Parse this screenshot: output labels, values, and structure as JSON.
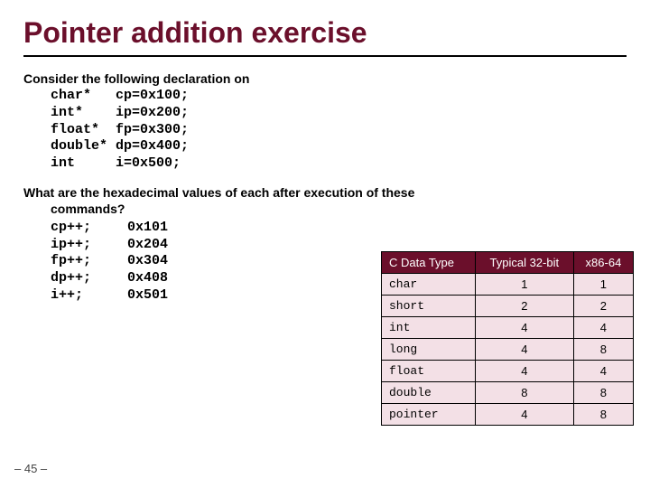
{
  "title": "Pointer addition exercise",
  "intro": "Consider the following declaration on",
  "decls": "char*   cp=0x100;\nint*    ip=0x200;\nfloat*  fp=0x300;\ndouble* dp=0x400;\nint     i=0x500;",
  "question1": "What are the hexadecimal values of each after execution of these",
  "question2": "commands?",
  "cmds": "cp++;\nip++;\nfp++;\ndp++;\ni++;",
  "answers": "0x101\n0x204\n0x304\n0x408\n0x501",
  "table": {
    "headers": [
      "C Data Type",
      "Typical 32-bit",
      "x86-64"
    ],
    "rows": [
      [
        "char",
        "1",
        "1"
      ],
      [
        "short",
        "2",
        "2"
      ],
      [
        "int",
        "4",
        "4"
      ],
      [
        "long",
        "4",
        "8"
      ],
      [
        "float",
        "4",
        "4"
      ],
      [
        "double",
        "8",
        "8"
      ],
      [
        "pointer",
        "4",
        "8"
      ]
    ]
  },
  "pagenum": "– 45 –"
}
